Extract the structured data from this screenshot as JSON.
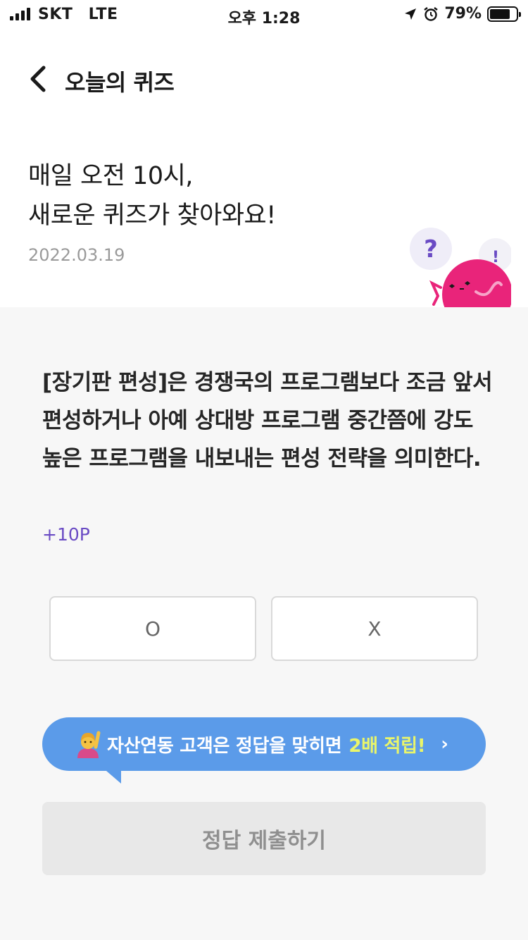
{
  "status_bar": {
    "carrier": "SKT",
    "network": "LTE",
    "time": "오후 1:28",
    "battery": "79%",
    "battery_level": 0.79
  },
  "header": {
    "title": "오늘의 퀴즈",
    "back_icon": "chevron-left-icon"
  },
  "intro": {
    "line1": "매일 오전 10시,",
    "line2": "새로운 퀴즈가 찾아와요!",
    "date": "2022.03.19"
  },
  "mascot": {
    "question_mark": "?",
    "exclamation_mark": "!"
  },
  "quiz": {
    "question": "[장기판 편성]은 경쟁국의 프로그램보다 조금 앞서 편성하거나 아예 상대방 프로그램 중간쯤에 강도 높은 프로그램을 내보내는 편성 전략을 의미한다.",
    "reward": "+10P",
    "answers": [
      {
        "label": "O"
      },
      {
        "label": "X"
      }
    ]
  },
  "promo": {
    "text": "자산연동 고객은 정답을 맞히면",
    "highlight": "2배 적립!",
    "chevron": "›",
    "colors": {
      "background": "#5b9be9",
      "highlight": "#e9f56a"
    }
  },
  "submit": {
    "label": "정답 제출하기"
  }
}
